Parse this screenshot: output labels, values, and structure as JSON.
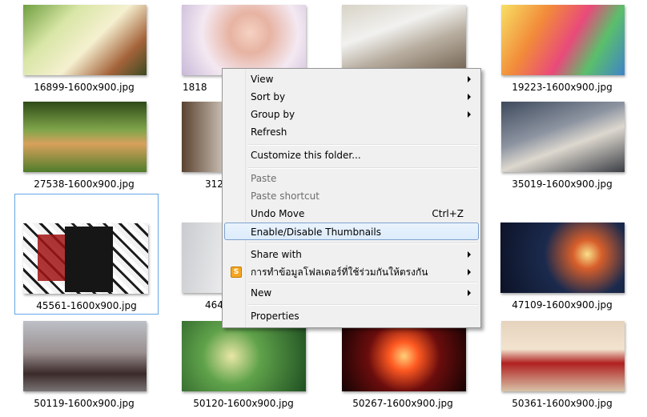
{
  "files": [
    {
      "name": "16899-1600x900.jpg"
    },
    {
      "name": "1818"
    },
    {
      "name": ""
    },
    {
      "name": "19223-1600x900.jpg"
    },
    {
      "name": "27538-1600x900.jpg"
    },
    {
      "name": "3124"
    },
    {
      "name": ""
    },
    {
      "name": "35019-1600x900.jpg"
    },
    {
      "name": "45561-1600x900.jpg"
    },
    {
      "name": "4645"
    },
    {
      "name": ""
    },
    {
      "name": "47109-1600x900.jpg"
    },
    {
      "name": "50119-1600x900.jpg"
    },
    {
      "name": "50120-1600x900.jpg"
    },
    {
      "name": "50267-1600x900.jpg"
    },
    {
      "name": "50361-1600x900.jpg"
    }
  ],
  "context_menu": {
    "view": "View",
    "sort_by": "Sort by",
    "group_by": "Group by",
    "refresh": "Refresh",
    "customize": "Customize this folder...",
    "paste": "Paste",
    "paste_shortcut": "Paste shortcut",
    "undo_move": "Undo Move",
    "undo_shortcut": "Ctrl+Z",
    "enable_disable_thumbnails": "Enable/Disable Thumbnails",
    "share_with": "Share with",
    "sync_folders": "การทำข้อมูลโฟลเดอร์ที่ใช้ร่วมกันให้ตรงกัน",
    "new": "New",
    "properties": "Properties"
  },
  "colors": {
    "selection_border": "#66a7e8",
    "menu_hover_border": "#7da2ce",
    "menu_background": "#f0f0f0"
  }
}
